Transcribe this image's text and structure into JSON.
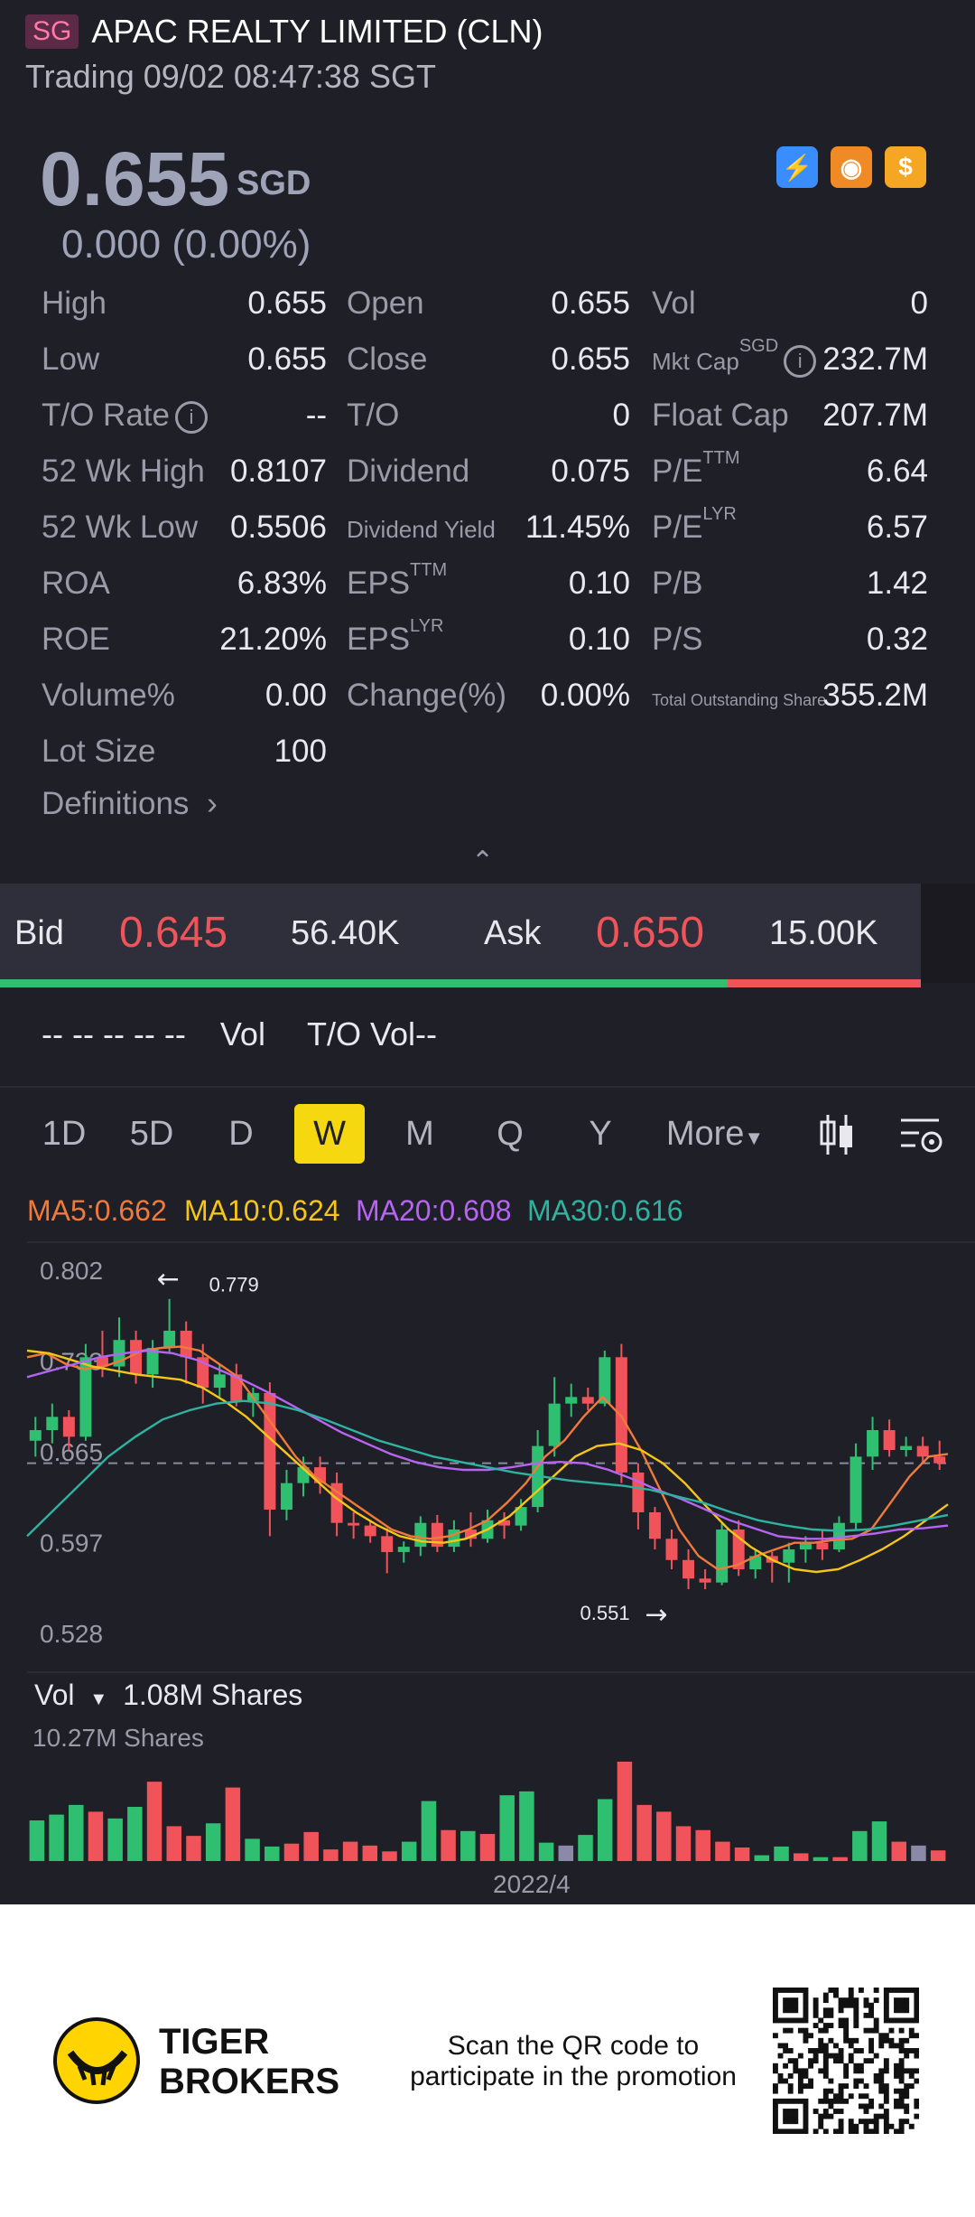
{
  "header": {
    "badge": "SG",
    "title": "APAC REALTY LIMITED (CLN)",
    "status": "Trading 09/02 08:47:38 SGT"
  },
  "quote": {
    "price": "0.655",
    "currency": "SGD",
    "change": "0.000 (0.00%)"
  },
  "header_icons": [
    {
      "name": "lightning-icon",
      "glyph": "⚡",
      "color": "#3a8dff"
    },
    {
      "name": "orange-badge-icon",
      "glyph": "◉",
      "color": "#f08a24"
    },
    {
      "name": "dollar-icon",
      "glyph": "$",
      "color": "#f5a623"
    }
  ],
  "stats": {
    "col1": [
      {
        "label": "High",
        "value": "0.655"
      },
      {
        "label": "Low",
        "value": "0.655"
      },
      {
        "label": "T/O Rate",
        "value": "--"
      },
      {
        "label": "52 Wk High",
        "value": "0.8107"
      },
      {
        "label": "52 Wk Low",
        "value": "0.5506"
      },
      {
        "label": "ROA",
        "value": "6.83%"
      },
      {
        "label": "ROE",
        "value": "21.20%"
      },
      {
        "label": "Volume%",
        "value": "0.00"
      },
      {
        "label": "Lot Size",
        "value": "100"
      }
    ],
    "col2": [
      {
        "label": "Open",
        "value": "0.655"
      },
      {
        "label": "Close",
        "value": "0.655"
      },
      {
        "label": "T/O",
        "value": "0"
      },
      {
        "label": "Dividend",
        "value": "0.075"
      },
      {
        "label": "Dividend Yield",
        "value": "11.45%"
      },
      {
        "label": "EPS",
        "sup": "TTM",
        "value": "0.10"
      },
      {
        "label": "EPS",
        "sup": "LYR",
        "value": "0.10"
      },
      {
        "label": "Change(%)",
        "value": "0.00%"
      }
    ],
    "col3": [
      {
        "label": "Vol",
        "value": "0"
      },
      {
        "label": "Mkt Cap",
        "sup": "SGD",
        "value": "232.7M"
      },
      {
        "label": "Float Cap",
        "value": "207.7M"
      },
      {
        "label": "P/E",
        "sup": "TTM",
        "value": "6.64"
      },
      {
        "label": "P/E",
        "sup": "LYR",
        "value": "6.57"
      },
      {
        "label": "P/B",
        "value": "1.42"
      },
      {
        "label": "P/S",
        "value": "0.32"
      },
      {
        "label": "Total Outstanding Share",
        "value": "355.2M"
      }
    ],
    "definitions_label": "Definitions"
  },
  "bidask": {
    "bid_label": "Bid",
    "bid_price": "0.645",
    "bid_size": "56.40K",
    "ask_label": "Ask",
    "ask_price": "0.650",
    "ask_size": "15.00K",
    "bid_fraction": 0.79
  },
  "volume_line": {
    "dashes": "-- -- -- -- --",
    "vol_label": "Vol",
    "to_vol": "T/O Vol--"
  },
  "periods": [
    "1D",
    "5D",
    "D",
    "W",
    "M",
    "Q",
    "Y",
    "More"
  ],
  "selected_period": "W",
  "ma": [
    {
      "label": "MA5:0.662",
      "color": "#f07a3a"
    },
    {
      "label": "MA10:0.624",
      "color": "#f5c518"
    },
    {
      "label": "MA20:0.608",
      "color": "#b565f0"
    },
    {
      "label": "MA30:0.616",
      "color": "#2fb3a0"
    }
  ],
  "chart_data": {
    "type": "candlestick",
    "y_ticks": [
      "0.802",
      "0.733",
      "0.665",
      "0.597",
      "0.528"
    ],
    "ylim": [
      0.528,
      0.802
    ],
    "current_price": 0.655,
    "max_label": "0.779",
    "min_label": "0.551",
    "candles": [
      [
        0.672,
        0.69,
        0.66,
        0.68
      ],
      [
        0.68,
        0.7,
        0.67,
        0.69
      ],
      [
        0.69,
        0.695,
        0.665,
        0.675
      ],
      [
        0.675,
        0.745,
        0.672,
        0.735
      ],
      [
        0.735,
        0.755,
        0.72,
        0.728
      ],
      [
        0.728,
        0.765,
        0.72,
        0.748
      ],
      [
        0.748,
        0.755,
        0.715,
        0.722
      ],
      [
        0.722,
        0.748,
        0.712,
        0.742
      ],
      [
        0.742,
        0.779,
        0.738,
        0.755
      ],
      [
        0.755,
        0.762,
        0.715,
        0.735
      ],
      [
        0.735,
        0.745,
        0.7,
        0.712
      ],
      [
        0.712,
        0.73,
        0.705,
        0.722
      ],
      [
        0.722,
        0.73,
        0.698,
        0.702
      ],
      [
        0.702,
        0.712,
        0.69,
        0.708
      ],
      [
        0.708,
        0.716,
        0.6,
        0.62
      ],
      [
        0.62,
        0.65,
        0.612,
        0.64
      ],
      [
        0.64,
        0.66,
        0.63,
        0.652
      ],
      [
        0.652,
        0.66,
        0.632,
        0.64
      ],
      [
        0.64,
        0.648,
        0.6,
        0.61
      ],
      [
        0.61,
        0.618,
        0.598,
        0.608
      ],
      [
        0.608,
        0.612,
        0.595,
        0.6
      ],
      [
        0.6,
        0.606,
        0.572,
        0.588
      ],
      [
        0.588,
        0.596,
        0.58,
        0.592
      ],
      [
        0.592,
        0.615,
        0.585,
        0.61
      ],
      [
        0.61,
        0.616,
        0.588,
        0.592
      ],
      [
        0.592,
        0.612,
        0.588,
        0.605
      ],
      [
        0.605,
        0.618,
        0.592,
        0.598
      ],
      [
        0.598,
        0.62,
        0.595,
        0.612
      ],
      [
        0.612,
        0.618,
        0.598,
        0.608
      ],
      [
        0.608,
        0.628,
        0.604,
        0.622
      ],
      [
        0.622,
        0.68,
        0.618,
        0.668
      ],
      [
        0.668,
        0.72,
        0.66,
        0.7
      ],
      [
        0.7,
        0.715,
        0.69,
        0.705
      ],
      [
        0.705,
        0.712,
        0.695,
        0.7
      ],
      [
        0.7,
        0.74,
        0.698,
        0.735
      ],
      [
        0.735,
        0.745,
        0.64,
        0.648
      ],
      [
        0.648,
        0.655,
        0.605,
        0.618
      ],
      [
        0.618,
        0.622,
        0.59,
        0.598
      ],
      [
        0.598,
        0.605,
        0.575,
        0.582
      ],
      [
        0.582,
        0.59,
        0.56,
        0.568
      ],
      [
        0.568,
        0.575,
        0.56,
        0.565
      ],
      [
        0.565,
        0.61,
        0.563,
        0.605
      ],
      [
        0.605,
        0.612,
        0.57,
        0.575
      ],
      [
        0.575,
        0.59,
        0.568,
        0.585
      ],
      [
        0.585,
        0.588,
        0.565,
        0.58
      ],
      [
        0.58,
        0.595,
        0.565,
        0.59
      ],
      [
        0.59,
        0.6,
        0.58,
        0.595
      ],
      [
        0.595,
        0.605,
        0.582,
        0.59
      ],
      [
        0.59,
        0.615,
        0.588,
        0.61
      ],
      [
        0.61,
        0.67,
        0.605,
        0.66
      ],
      [
        0.66,
        0.69,
        0.65,
        0.68
      ],
      [
        0.68,
        0.688,
        0.66,
        0.665
      ],
      [
        0.665,
        0.675,
        0.66,
        0.668
      ],
      [
        0.668,
        0.675,
        0.655,
        0.66
      ],
      [
        0.66,
        0.672,
        0.65,
        0.655
      ]
    ],
    "ma_series": [
      {
        "name": "MA5",
        "values": [
          0.735,
          0.738,
          0.73,
          0.726,
          0.728,
          0.733,
          0.74,
          0.742,
          0.743,
          0.74,
          0.73,
          0.72,
          0.7,
          0.68,
          0.66,
          0.645,
          0.635,
          0.625,
          0.615,
          0.605,
          0.6,
          0.598,
          0.6,
          0.605,
          0.612,
          0.625,
          0.64,
          0.66,
          0.672,
          0.69,
          0.705,
          0.69,
          0.665,
          0.635,
          0.605,
          0.585,
          0.575,
          0.578,
          0.585,
          0.59,
          0.595,
          0.595,
          0.597,
          0.598,
          0.605,
          0.625,
          0.645,
          0.66,
          0.662
        ]
      },
      {
        "name": "MA10",
        "values": [
          0.74,
          0.738,
          0.733,
          0.728,
          0.725,
          0.722,
          0.72,
          0.718,
          0.712,
          0.702,
          0.69,
          0.675,
          0.66,
          0.645,
          0.63,
          0.618,
          0.608,
          0.6,
          0.596,
          0.595,
          0.598,
          0.605,
          0.615,
          0.63,
          0.645,
          0.66,
          0.668,
          0.67,
          0.665,
          0.655,
          0.64,
          0.622,
          0.605,
          0.592,
          0.582,
          0.575,
          0.573,
          0.575,
          0.582,
          0.59,
          0.6,
          0.612,
          0.624
        ]
      },
      {
        "name": "MA20",
        "values": [
          0.72,
          0.725,
          0.73,
          0.735,
          0.738,
          0.74,
          0.738,
          0.733,
          0.725,
          0.717,
          0.708,
          0.698,
          0.688,
          0.678,
          0.67,
          0.662,
          0.656,
          0.652,
          0.65,
          0.65,
          0.652,
          0.655,
          0.656,
          0.655,
          0.65,
          0.643,
          0.635,
          0.628,
          0.62,
          0.612,
          0.606,
          0.6,
          0.598,
          0.598,
          0.6,
          0.602,
          0.605,
          0.606,
          0.608
        ]
      },
      {
        "name": "MA30",
        "values": [
          0.6,
          0.62,
          0.64,
          0.66,
          0.675,
          0.688,
          0.695,
          0.7,
          0.702,
          0.7,
          0.695,
          0.688,
          0.68,
          0.672,
          0.666,
          0.66,
          0.656,
          0.652,
          0.648,
          0.645,
          0.642,
          0.64,
          0.638,
          0.635,
          0.63,
          0.625,
          0.618,
          0.612,
          0.608,
          0.605,
          0.604,
          0.605,
          0.608,
          0.612,
          0.616
        ]
      }
    ]
  },
  "volume": {
    "header_label": "Vol",
    "header_value": "1.08M Shares",
    "max_label": "10.27M Shares",
    "date_label": "2022/4",
    "bars": [
      [
        4.2,
        "g"
      ],
      [
        4.8,
        "g"
      ],
      [
        5.8,
        "g"
      ],
      [
        5.1,
        "r"
      ],
      [
        4.4,
        "g"
      ],
      [
        5.6,
        "g"
      ],
      [
        8.2,
        "r"
      ],
      [
        3.6,
        "r"
      ],
      [
        2.6,
        "r"
      ],
      [
        3.9,
        "g"
      ],
      [
        7.6,
        "r"
      ],
      [
        2.3,
        "g"
      ],
      [
        1.5,
        "g"
      ],
      [
        1.8,
        "r"
      ],
      [
        3.0,
        "r"
      ],
      [
        1.2,
        "r"
      ],
      [
        2.0,
        "r"
      ],
      [
        1.6,
        "r"
      ],
      [
        1.0,
        "r"
      ],
      [
        2.0,
        "g"
      ],
      [
        6.2,
        "g"
      ],
      [
        3.2,
        "r"
      ],
      [
        3.1,
        "g"
      ],
      [
        2.8,
        "r"
      ],
      [
        6.8,
        "g"
      ],
      [
        7.2,
        "g"
      ],
      [
        1.9,
        "g"
      ],
      [
        1.6,
        "o"
      ],
      [
        2.7,
        "g"
      ],
      [
        6.4,
        "g"
      ],
      [
        10.27,
        "r"
      ],
      [
        5.8,
        "r"
      ],
      [
        5.1,
        "r"
      ],
      [
        3.6,
        "r"
      ],
      [
        3.2,
        "r"
      ],
      [
        2.0,
        "r"
      ],
      [
        1.4,
        "r"
      ],
      [
        0.6,
        "g"
      ],
      [
        1.5,
        "g"
      ],
      [
        0.8,
        "r"
      ],
      [
        0.4,
        "g"
      ],
      [
        0.4,
        "r"
      ],
      [
        3.1,
        "g"
      ],
      [
        4.1,
        "g"
      ],
      [
        2.0,
        "r"
      ],
      [
        1.6,
        "o"
      ],
      [
        1.1,
        "r"
      ]
    ]
  },
  "footer": {
    "brand_line1": "TIGER",
    "brand_line2": "BROKERS",
    "promo_line1": "Scan the QR code to",
    "promo_line2": "participate in the promotion"
  }
}
